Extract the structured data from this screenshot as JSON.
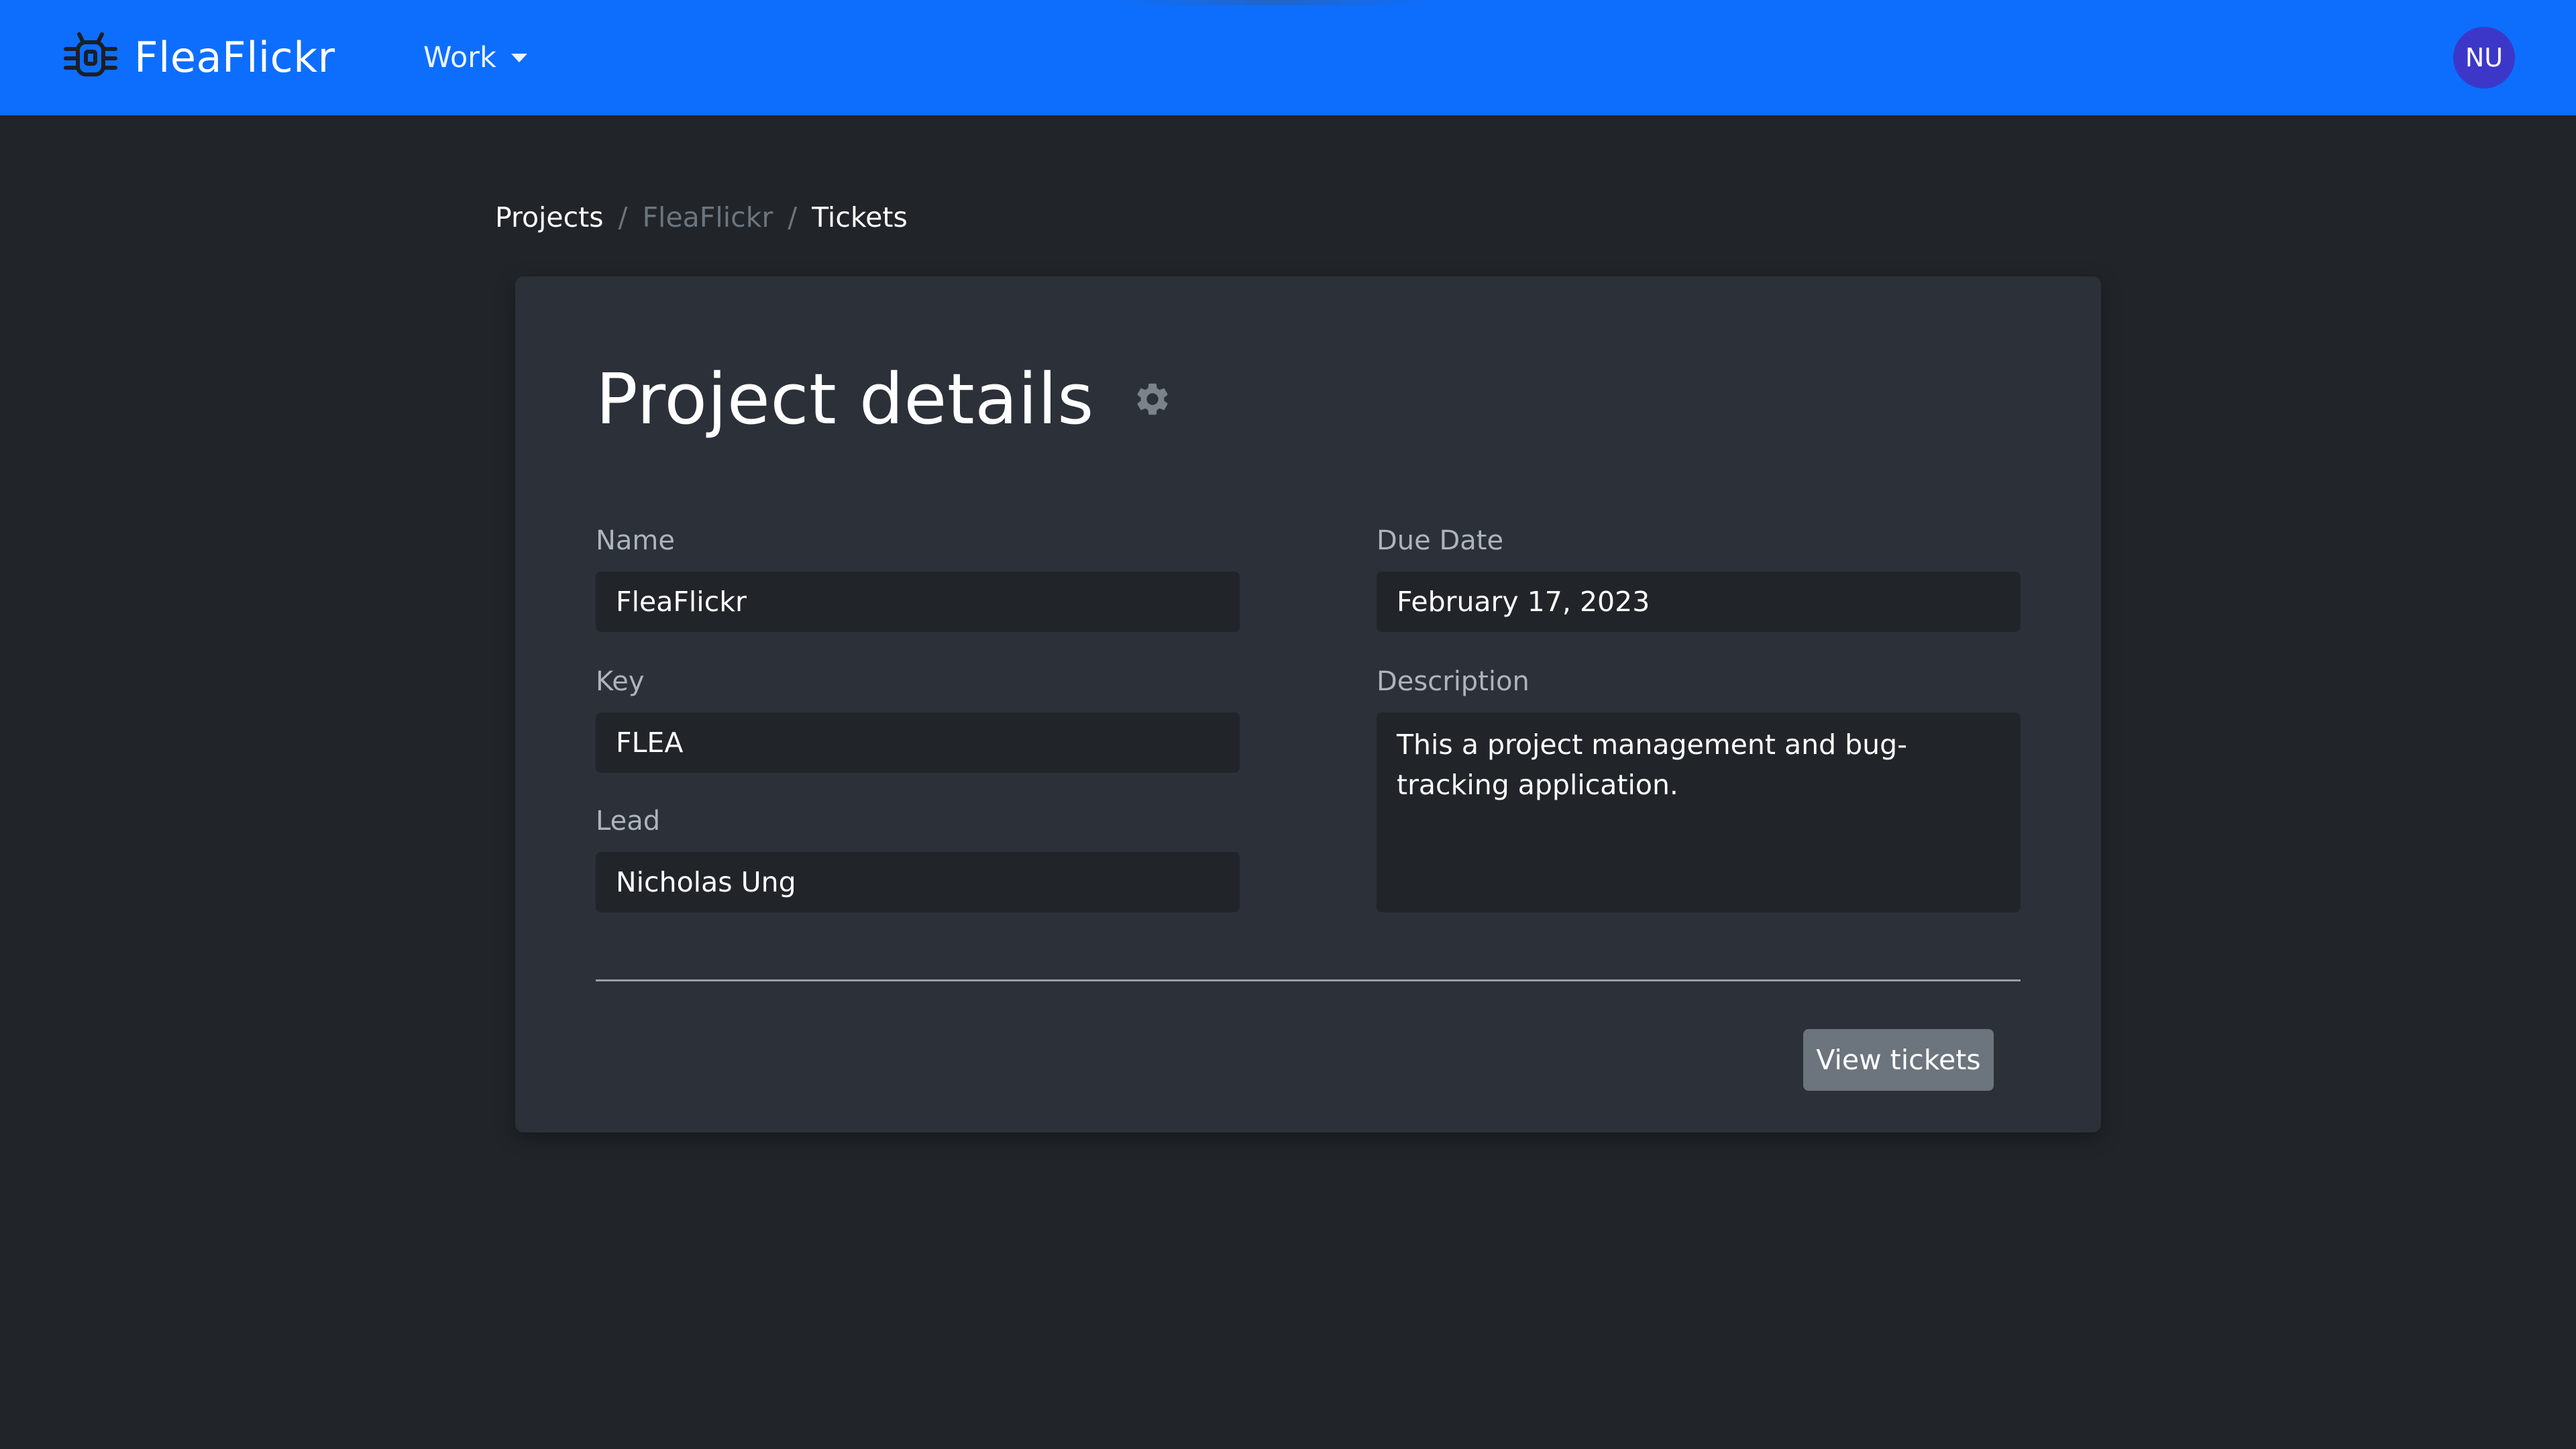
{
  "navbar": {
    "brand": "FleaFlickr",
    "dropdown_label": "Work",
    "avatar_initials": "NU",
    "colors": {
      "background": "#0d6efd",
      "avatar": "#3d37c9"
    }
  },
  "breadcrumb": {
    "items": [
      {
        "label": "Projects",
        "active": false
      },
      {
        "label": "FleaFlickr",
        "active": true
      },
      {
        "label": "Tickets",
        "active": false
      }
    ],
    "separator": "/"
  },
  "project": {
    "title": "Project details",
    "settings_icon": "gear-icon",
    "fields": {
      "name": {
        "label": "Name",
        "value": "FleaFlickr"
      },
      "key": {
        "label": "Key",
        "value": "FLEA"
      },
      "lead": {
        "label": "Lead",
        "value": "Nicholas Ung"
      },
      "due_date": {
        "label": "Due Date",
        "value": "February 17, 2023"
      },
      "description": {
        "label": "Description",
        "value": "This a project management and bug-tracking application."
      }
    },
    "actions": {
      "view_tickets": "View tickets"
    }
  }
}
